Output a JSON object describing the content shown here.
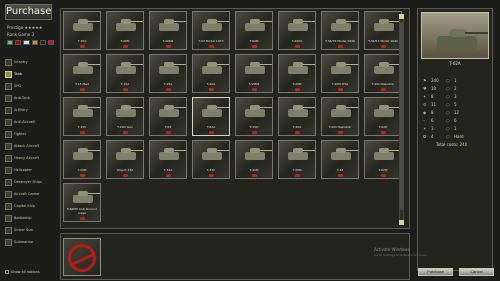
{
  "window": {
    "title": "Purchase"
  },
  "player": {
    "prestige_label": "Prestige",
    "prestige_stars": "★★★★★",
    "rank_label": "Rank Game",
    "rank_value": "3"
  },
  "categories": [
    "Infantry",
    "Tank",
    "SPG",
    "Anti-Tank",
    "Artillery",
    "Anti-Aircraft",
    "Fighter",
    "Attack Aircraft",
    "Heavy Aircraft",
    "Helicopter",
    "Destroyer Ships",
    "Aircraft Carrier",
    "Capital Ship",
    "Battleship",
    "Sinker Sub",
    "Submarine"
  ],
  "active_category": "Tank",
  "show_all": "Show all nations",
  "vehicles": [
    "T-15A",
    "T-20M",
    "T-20M2",
    "T-52 Model 1973",
    "T-62M",
    "T-20PU",
    "T-34/76 Model 1940",
    "T-34/57 Model 1941",
    "T-15 Med",
    "T-15A",
    "T-15A",
    "T-20A",
    "T-15M1",
    "T-20M",
    "T-20M-H5A",
    "T-20U Republic",
    "T-15C",
    "T-20U Gen",
    "T-62",
    "T-62A",
    "T-15D",
    "T-20A",
    "T-20U Republic",
    "T-62U",
    "T-20M",
    "Object 430",
    "T-34A",
    "T-34C",
    "T-40M",
    "T-20M",
    "T-44",
    "T-62M",
    "T-62M2 Anti-Ground Cage"
  ],
  "selected_vehicle": "T-62A",
  "stats": [
    [
      "⚑",
      "240",
      "⬡",
      "1"
    ],
    [
      "♥",
      "10",
      "⬡",
      "2"
    ],
    [
      "✦",
      "8",
      "⬡",
      "3"
    ],
    [
      "⚙",
      "11",
      "⬡",
      "5"
    ],
    [
      "◆",
      "8",
      "⬡",
      "12"
    ],
    [
      "⌁",
      "6",
      "⬡",
      "6"
    ],
    [
      "✶",
      "3",
      "⬡",
      "1"
    ],
    [
      "✪",
      "4",
      "⬡",
      "Hard"
    ]
  ],
  "total": {
    "label": "Total costs:",
    "value": "240"
  },
  "buttons": {
    "purchase": "Purchase",
    "cancel": "Cancel"
  },
  "watermark": {
    "main": "Activate Windows",
    "sub": "Go to Settings to activate Windows."
  },
  "colors": {
    "accent": "#e0d56a",
    "panel": "#24241f",
    "background": "#1d1d1b"
  }
}
